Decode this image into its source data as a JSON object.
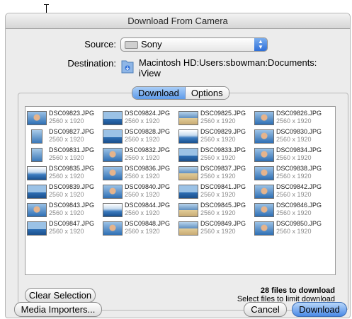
{
  "window": {
    "title": "Download From Camera"
  },
  "source": {
    "label": "Source:",
    "value": "Sony",
    "icon": "camera-icon"
  },
  "destination": {
    "label": "Destination:",
    "path": "Macintosh HD:Users:sbowman:Documents:",
    "path_line2": "iView",
    "icon": "folder-icon"
  },
  "tabs": [
    {
      "label": "Download",
      "selected": true
    },
    {
      "label": "Options",
      "selected": false
    }
  ],
  "files": [
    {
      "name": "DSC09823.JPG",
      "dims": "2560 x 1920",
      "thumb": "fig"
    },
    {
      "name": "DSC09824.JPG",
      "dims": "2560 x 1920",
      "thumb": "sky"
    },
    {
      "name": "DSC09825.JPG",
      "dims": "2560 x 1920",
      "thumb": "sea"
    },
    {
      "name": "DSC09826.JPG",
      "dims": "2560 x 1920",
      "thumb": "fig"
    },
    {
      "name": "DSC09827.JPG",
      "dims": "2560 x 1920",
      "thumb": "port"
    },
    {
      "name": "DSC09828.JPG",
      "dims": "2560 x 1920",
      "thumb": "sky"
    },
    {
      "name": "DSC09829.JPG",
      "dims": "2560 x 1920",
      "thumb": "cloud"
    },
    {
      "name": "DSC09830.JPG",
      "dims": "2560 x 1920",
      "thumb": "fig"
    },
    {
      "name": "DSC09831.JPG",
      "dims": "2560 x 1920",
      "thumb": "port"
    },
    {
      "name": "DSC09832.JPG",
      "dims": "2560 x 1920",
      "thumb": "fig"
    },
    {
      "name": "DSC09833.JPG",
      "dims": "2560 x 1920",
      "thumb": "sky"
    },
    {
      "name": "DSC09834.JPG",
      "dims": "2560 x 1920",
      "thumb": "fig"
    },
    {
      "name": "DSC09835.JPG",
      "dims": "2560 x 1920",
      "thumb": "cloud"
    },
    {
      "name": "DSC09836.JPG",
      "dims": "2560 x 1920",
      "thumb": "fig"
    },
    {
      "name": "DSC09837.JPG",
      "dims": "2560 x 1920",
      "thumb": "sea"
    },
    {
      "name": "DSC09838.JPG",
      "dims": "2560 x 1920",
      "thumb": "fig"
    },
    {
      "name": "DSC09839.JPG",
      "dims": "2560 x 1920",
      "thumb": "sky"
    },
    {
      "name": "DSC09840.JPG",
      "dims": "2560 x 1920",
      "thumb": "fig"
    },
    {
      "name": "DSC09841.JPG",
      "dims": "2560 x 1920",
      "thumb": "sky"
    },
    {
      "name": "DSC09842.JPG",
      "dims": "2560 x 1920",
      "thumb": "fig"
    },
    {
      "name": "DSC09843.JPG",
      "dims": "2560 x 1920",
      "thumb": "fig"
    },
    {
      "name": "DSC09844.JPG",
      "dims": "2560 x 1920",
      "thumb": "cloud"
    },
    {
      "name": "DSC09845.JPG",
      "dims": "2560 x 1920",
      "thumb": "sea"
    },
    {
      "name": "DSC09846.JPG",
      "dims": "2560 x 1920",
      "thumb": "fig"
    },
    {
      "name": "DSC09847.JPG",
      "dims": "2560 x 1920",
      "thumb": "sky"
    },
    {
      "name": "DSC09848.JPG",
      "dims": "2560 x 1920",
      "thumb": "fig"
    },
    {
      "name": "DSC09849.JPG",
      "dims": "2560 x 1920",
      "thumb": "sea"
    },
    {
      "name": "DSC09850.JPG",
      "dims": "2560 x 1920",
      "thumb": "fig"
    }
  ],
  "summary": {
    "count_text": "28 files to download",
    "hint": "Select files to limit download"
  },
  "buttons": {
    "clear_selection": "Clear Selection",
    "media_importers": "Media Importers...",
    "cancel": "Cancel",
    "download": "Download"
  },
  "colors": {
    "accent": "#5e9ae9",
    "window_bg": "#ececec"
  }
}
